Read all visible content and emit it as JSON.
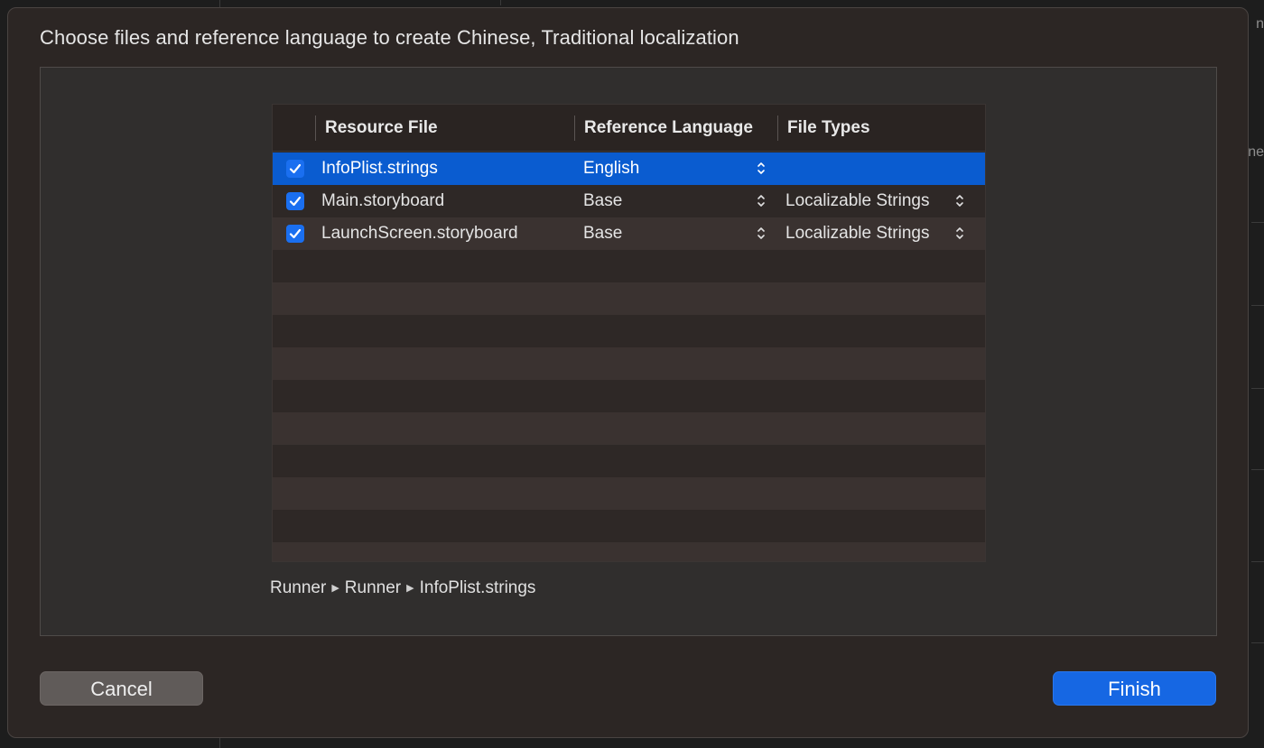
{
  "background": {
    "edge_fragments": [
      "n",
      "ne"
    ]
  },
  "dialog": {
    "title": "Choose files and reference language to create Chinese, Traditional localization",
    "table": {
      "columns": [
        "Resource File",
        "Reference Language",
        "File Types"
      ],
      "rows": [
        {
          "checked": true,
          "file": "InfoPlist.strings",
          "language": "English",
          "file_type": "",
          "selected": true
        },
        {
          "checked": true,
          "file": "Main.storyboard",
          "language": "Base",
          "file_type": "Localizable Strings",
          "selected": false
        },
        {
          "checked": true,
          "file": "LaunchScreen.storyboard",
          "language": "Base",
          "file_type": "Localizable Strings",
          "selected": false
        }
      ]
    },
    "path": [
      "Runner",
      "Runner",
      "InfoPlist.strings"
    ],
    "buttons": {
      "cancel": "Cancel",
      "finish": "Finish"
    },
    "colors": {
      "selection": "#0a5cd0",
      "checkbox": "#1a6ff0",
      "primary_button": "#1667e3"
    }
  }
}
